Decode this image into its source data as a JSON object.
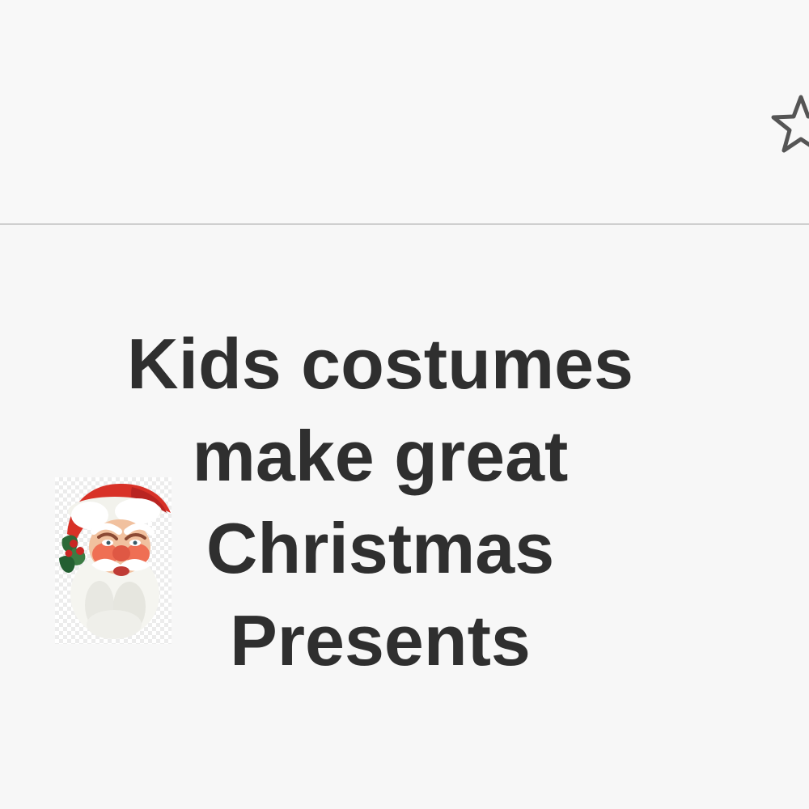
{
  "header": {
    "favorite_icon": "star-icon"
  },
  "post": {
    "title_lines": [
      "Kids costumes",
      "make great",
      "Christmas",
      "Presents"
    ],
    "image_icon": "santa-claus-icon"
  },
  "colors": {
    "background": "#f7f7f7",
    "divider": "#cfcfcf",
    "text": "#2f2f2f",
    "star_outline": "#555555",
    "santa_red": "#d83127",
    "beard_white": "#f5f5f0"
  }
}
